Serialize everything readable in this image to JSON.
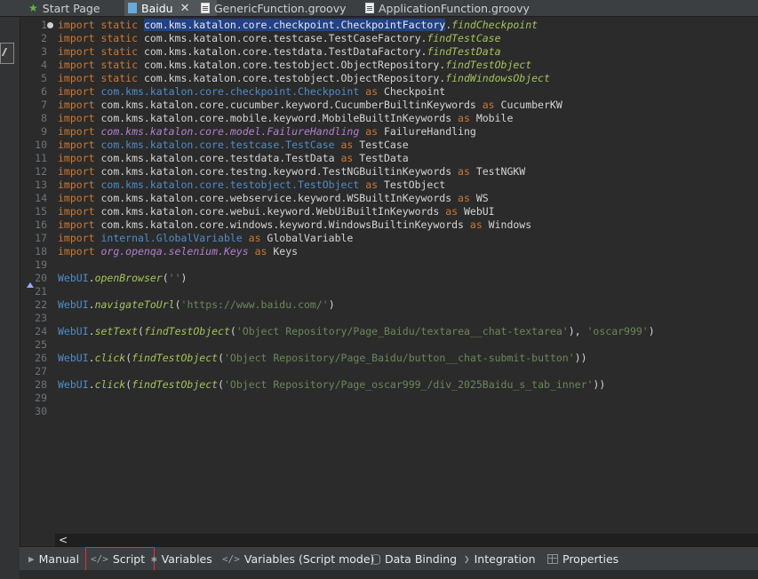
{
  "tabs": [
    {
      "label": "Start Page",
      "icon": "star-icon"
    },
    {
      "label": "Baidu",
      "icon": "test-case-icon",
      "active": true
    },
    {
      "label": "GenericFunction.groovy",
      "icon": "groovy-file-icon"
    },
    {
      "label": "ApplicationFunction.groovy",
      "icon": "groovy-file-icon"
    }
  ],
  "lines": [
    {
      "num": "1",
      "tokens": [
        [
          "k",
          "import static "
        ],
        [
          "sel",
          "com.kms.katalon.core.checkpoint.CheckpointFactory"
        ],
        [
          "p",
          "."
        ],
        [
          "m",
          "findCheckpoint"
        ]
      ]
    },
    {
      "num": "2",
      "tokens": [
        [
          "k",
          "import static "
        ],
        [
          "p",
          "com.kms.katalon.core.testcase.TestCaseFactory."
        ],
        [
          "m",
          "findTestCase"
        ]
      ]
    },
    {
      "num": "3",
      "tokens": [
        [
          "k",
          "import static "
        ],
        [
          "p",
          "com.kms.katalon.core.testdata.TestDataFactory."
        ],
        [
          "m",
          "findTestData"
        ]
      ]
    },
    {
      "num": "4",
      "tokens": [
        [
          "k",
          "import static "
        ],
        [
          "p",
          "com.kms.katalon.core.testobject.ObjectRepository."
        ],
        [
          "m",
          "findTestObject"
        ]
      ]
    },
    {
      "num": "5",
      "tokens": [
        [
          "k",
          "import static "
        ],
        [
          "p",
          "com.kms.katalon.core.testobject.ObjectRepository."
        ],
        [
          "m",
          "findWindowsObject"
        ]
      ]
    },
    {
      "num": "6",
      "tokens": [
        [
          "k",
          "import "
        ],
        [
          "c",
          "com.kms.katalon.core.checkpoint.Checkpoint"
        ],
        [
          "k",
          " as "
        ],
        [
          "p",
          "Checkpoint"
        ]
      ]
    },
    {
      "num": "7",
      "tokens": [
        [
          "k",
          "import "
        ],
        [
          "p",
          "com.kms.katalon.core.cucumber.keyword.CucumberBuiltinKeywords"
        ],
        [
          "k",
          " as "
        ],
        [
          "p",
          "CucumberKW"
        ]
      ]
    },
    {
      "num": "8",
      "tokens": [
        [
          "k",
          "import "
        ],
        [
          "p",
          "com.kms.katalon.core.mobile.keyword.MobileBuiltInKeywords"
        ],
        [
          "k",
          " as "
        ],
        [
          "p",
          "Mobile"
        ]
      ]
    },
    {
      "num": "9",
      "tokens": [
        [
          "k",
          "import "
        ],
        [
          "i",
          "com.kms.katalon.core.model.FailureHandling"
        ],
        [
          "k",
          " as "
        ],
        [
          "p",
          "FailureHandling"
        ]
      ]
    },
    {
      "num": "10",
      "tokens": [
        [
          "k",
          "import "
        ],
        [
          "c",
          "com.kms.katalon.core.testcase.TestCase"
        ],
        [
          "k",
          " as "
        ],
        [
          "p",
          "TestCase"
        ]
      ]
    },
    {
      "num": "11",
      "tokens": [
        [
          "k",
          "import "
        ],
        [
          "p",
          "com.kms.katalon.core.testdata.TestData"
        ],
        [
          "k",
          " as "
        ],
        [
          "p",
          "TestData"
        ]
      ]
    },
    {
      "num": "12",
      "tokens": [
        [
          "k",
          "import "
        ],
        [
          "p",
          "com.kms.katalon.core.testng.keyword.TestNGBuiltinKeywords"
        ],
        [
          "k",
          " as "
        ],
        [
          "p",
          "TestNGKW"
        ]
      ]
    },
    {
      "num": "13",
      "tokens": [
        [
          "k",
          "import "
        ],
        [
          "c",
          "com.kms.katalon.core.testobject.TestObject"
        ],
        [
          "k",
          " as "
        ],
        [
          "p",
          "TestObject"
        ]
      ]
    },
    {
      "num": "14",
      "tokens": [
        [
          "k",
          "import "
        ],
        [
          "p",
          "com.kms.katalon.core.webservice.keyword.WSBuiltInKeywords"
        ],
        [
          "k",
          " as "
        ],
        [
          "p",
          "WS"
        ]
      ]
    },
    {
      "num": "15",
      "tokens": [
        [
          "k",
          "import "
        ],
        [
          "p",
          "com.kms.katalon.core.webui.keyword.WebUiBuiltInKeywords"
        ],
        [
          "k",
          " as "
        ],
        [
          "p",
          "WebUI"
        ]
      ]
    },
    {
      "num": "16",
      "tokens": [
        [
          "k",
          "import "
        ],
        [
          "p",
          "com.kms.katalon.core.windows.keyword.WindowsBuiltinKeywords"
        ],
        [
          "k",
          " as "
        ],
        [
          "p",
          "Windows"
        ]
      ]
    },
    {
      "num": "17",
      "tokens": [
        [
          "k",
          "import "
        ],
        [
          "c",
          "internal.GlobalVariable"
        ],
        [
          "k",
          " as "
        ],
        [
          "p",
          "GlobalVariable"
        ]
      ]
    },
    {
      "num": "18",
      "tokens": [
        [
          "k",
          "import "
        ],
        [
          "i",
          "org.openqa.selenium.Keys"
        ],
        [
          "k",
          " as "
        ],
        [
          "p",
          "Keys"
        ]
      ]
    },
    {
      "num": "19",
      "tokens": []
    },
    {
      "num": "20",
      "tokens": [
        [
          "c",
          "WebUI"
        ],
        [
          "p",
          "."
        ],
        [
          "m",
          "openBrowser"
        ],
        [
          "p",
          "("
        ],
        [
          "s",
          "''"
        ],
        [
          "p",
          ")"
        ]
      ]
    },
    {
      "num": "21",
      "tokens": []
    },
    {
      "num": "22",
      "tokens": [
        [
          "c",
          "WebUI"
        ],
        [
          "p",
          "."
        ],
        [
          "m",
          "navigateToUrl"
        ],
        [
          "p",
          "("
        ],
        [
          "s",
          "'https://www.baidu.com/'"
        ],
        [
          "p",
          ")"
        ]
      ]
    },
    {
      "num": "23",
      "tokens": []
    },
    {
      "num": "24",
      "tokens": [
        [
          "c",
          "WebUI"
        ],
        [
          "p",
          "."
        ],
        [
          "m",
          "setText"
        ],
        [
          "p",
          "("
        ],
        [
          "m",
          "findTestObject"
        ],
        [
          "p",
          "("
        ],
        [
          "s",
          "'Object Repository/Page_Baidu/textarea__chat-textarea'"
        ],
        [
          "p",
          "), "
        ],
        [
          "s",
          "'oscar999'"
        ],
        [
          "p",
          ")"
        ]
      ]
    },
    {
      "num": "25",
      "tokens": []
    },
    {
      "num": "26",
      "tokens": [
        [
          "c",
          "WebUI"
        ],
        [
          "p",
          "."
        ],
        [
          "m",
          "click"
        ],
        [
          "p",
          "("
        ],
        [
          "m",
          "findTestObject"
        ],
        [
          "p",
          "("
        ],
        [
          "s",
          "'Object Repository/Page_Baidu/button__chat-submit-button'"
        ],
        [
          "p",
          "))"
        ]
      ]
    },
    {
      "num": "27",
      "tokens": []
    },
    {
      "num": "28",
      "tokens": [
        [
          "c",
          "WebUI"
        ],
        [
          "p",
          "."
        ],
        [
          "m",
          "click"
        ],
        [
          "p",
          "("
        ],
        [
          "m",
          "findTestObject"
        ],
        [
          "p",
          "("
        ],
        [
          "s",
          "'Object Repository/Page_oscar999_/div_2025Baidu_s_tab_inner'"
        ],
        [
          "p",
          "))"
        ]
      ]
    },
    {
      "num": "29",
      "tokens": []
    },
    {
      "num": "30",
      "tokens": []
    }
  ],
  "mode_tabs": [
    {
      "label": "Manual",
      "icon": "manual-icon"
    },
    {
      "label": "Script",
      "icon": "code-icon",
      "active": true
    },
    {
      "label": "Variables",
      "icon": "variables-icon"
    },
    {
      "label": "Variables (Script mode)",
      "icon": "code-icon"
    },
    {
      "label": "Data Binding",
      "icon": "database-icon"
    },
    {
      "label": "Integration",
      "icon": "integration-icon"
    },
    {
      "label": "Properties",
      "icon": "table-icon"
    }
  ],
  "colors": {
    "keyword": "#cc7832",
    "string": "#6a8759",
    "method": "#a5c25c",
    "class": "#4f8cc9",
    "selection": "#214283",
    "background": "#2b2b2b",
    "active_tab_outline": "#e03131"
  },
  "scroll": {
    "left_arrow": "<"
  }
}
